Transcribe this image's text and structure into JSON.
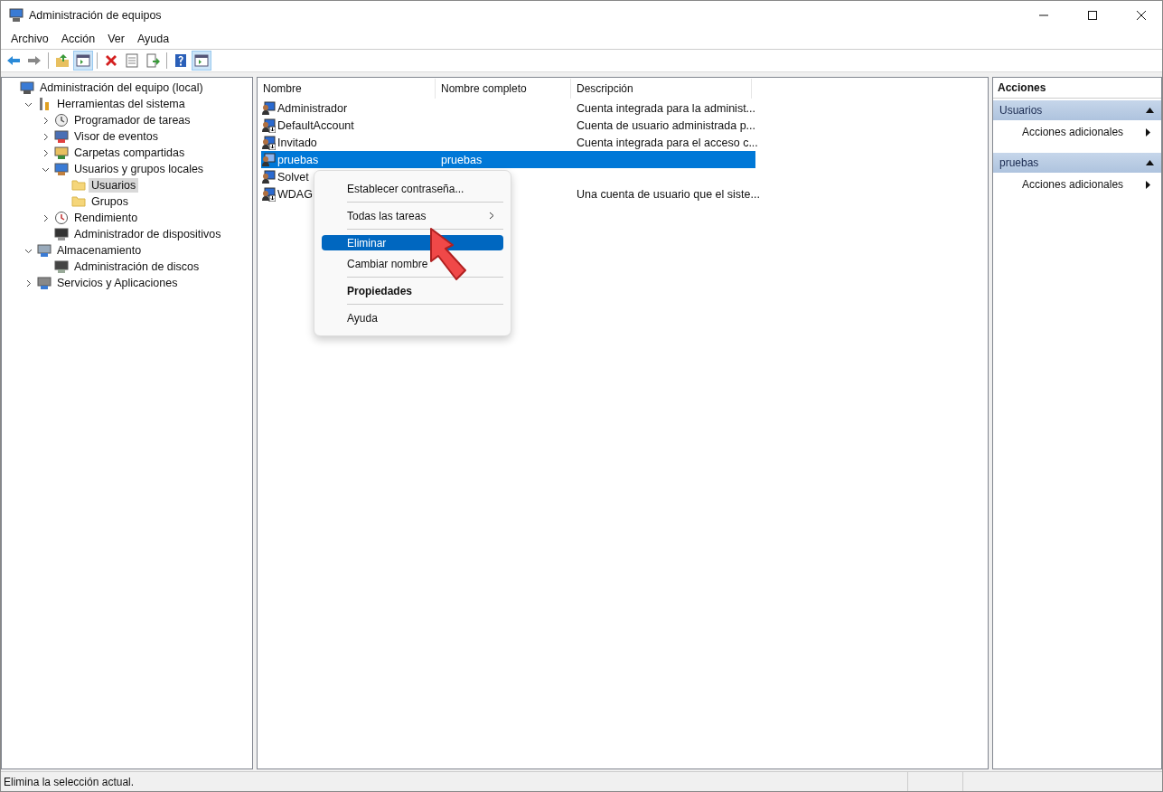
{
  "window": {
    "title": "Administración de equipos"
  },
  "menu": [
    "Archivo",
    "Acción",
    "Ver",
    "Ayuda"
  ],
  "toolbar": [
    [
      {
        "kind": "back",
        "selected": false
      },
      {
        "kind": "forward",
        "selected": false
      }
    ],
    [
      {
        "kind": "up",
        "selected": false
      },
      {
        "kind": "tree",
        "selected": true
      }
    ],
    [
      {
        "kind": "delete",
        "selected": false
      },
      {
        "kind": "properties",
        "selected": false
      },
      {
        "kind": "export",
        "selected": false
      }
    ],
    [
      {
        "kind": "help",
        "selected": false
      },
      {
        "kind": "actions",
        "selected": true
      }
    ]
  ],
  "tree": [
    {
      "label": "Administración del equipo (local)",
      "kind": "computer",
      "selected": false,
      "children": [
        {
          "label": "Herramientas del sistema",
          "kind": "tools",
          "expanded": true,
          "selected": false,
          "children": [
            {
              "label": "Programador de tareas",
              "kind": "clock",
              "expanded": false,
              "selected": false
            },
            {
              "label": "Visor de eventos",
              "kind": "event",
              "expanded": false,
              "selected": false
            },
            {
              "label": "Carpetas compartidas",
              "kind": "share",
              "expanded": false,
              "selected": false
            },
            {
              "label": "Usuarios y grupos locales",
              "kind": "users",
              "expanded": true,
              "selected": false,
              "children": [
                {
                  "label": "Usuarios",
                  "kind": "folder",
                  "selected": true
                },
                {
                  "label": "Grupos",
                  "kind": "folder",
                  "selected": false
                }
              ]
            },
            {
              "label": "Rendimiento",
              "kind": "perf",
              "expanded": false,
              "selected": false
            },
            {
              "label": "Administrador de dispositivos",
              "kind": "device",
              "selected": false
            }
          ]
        },
        {
          "label": "Almacenamiento",
          "kind": "storage",
          "expanded": true,
          "selected": false,
          "children": [
            {
              "label": "Administración de discos",
              "kind": "disk",
              "selected": false
            }
          ]
        },
        {
          "label": "Servicios y Aplicaciones",
          "kind": "services",
          "expanded": false,
          "selected": false
        }
      ]
    }
  ],
  "list": {
    "columns": [
      "Nombre",
      "Nombre completo",
      "Descripción"
    ],
    "rows": [
      {
        "name": "Administrador",
        "full_name": "",
        "description": "Cuenta integrada para la administ...",
        "disabled": false,
        "selected": false
      },
      {
        "name": "DefaultAccount",
        "full_name": "",
        "description": "Cuenta de usuario administrada p...",
        "disabled": true,
        "selected": false
      },
      {
        "name": "Invitado",
        "full_name": "",
        "description": "Cuenta integrada para el acceso c...",
        "disabled": true,
        "selected": false
      },
      {
        "name": "pruebas",
        "full_name": "pruebas",
        "description": "",
        "disabled": false,
        "selected": true
      },
      {
        "name": "Solvet",
        "full_name": "",
        "description": "",
        "disabled": false,
        "selected": false
      },
      {
        "name": "WDAG",
        "full_name": "",
        "description": "Una cuenta de usuario que el siste...",
        "disabled": true,
        "selected": false
      }
    ]
  },
  "context_menu": [
    {
      "kind": "item",
      "label": "Establecer contraseña...",
      "bold": false,
      "selected": false
    },
    {
      "kind": "separator"
    },
    {
      "kind": "submenu",
      "label": "Todas las tareas",
      "bold": false,
      "selected": false
    },
    {
      "kind": "separator"
    },
    {
      "kind": "item",
      "label": "Eliminar",
      "bold": false,
      "selected": true
    },
    {
      "kind": "item",
      "label": "Cambiar nombre",
      "bold": false,
      "selected": false
    },
    {
      "kind": "separator"
    },
    {
      "kind": "item",
      "label": "Propiedades",
      "bold": true,
      "selected": false
    },
    {
      "kind": "separator"
    },
    {
      "kind": "item",
      "label": "Ayuda",
      "bold": false,
      "selected": false
    }
  ],
  "actions": {
    "title": "Acciones",
    "sections": [
      {
        "title": "Usuarios",
        "items": [
          "Acciones adicionales"
        ]
      },
      {
        "title": "pruebas",
        "items": [
          "Acciones adicionales"
        ]
      }
    ]
  },
  "status_bar": {
    "text": "Elimina la selección actual."
  }
}
